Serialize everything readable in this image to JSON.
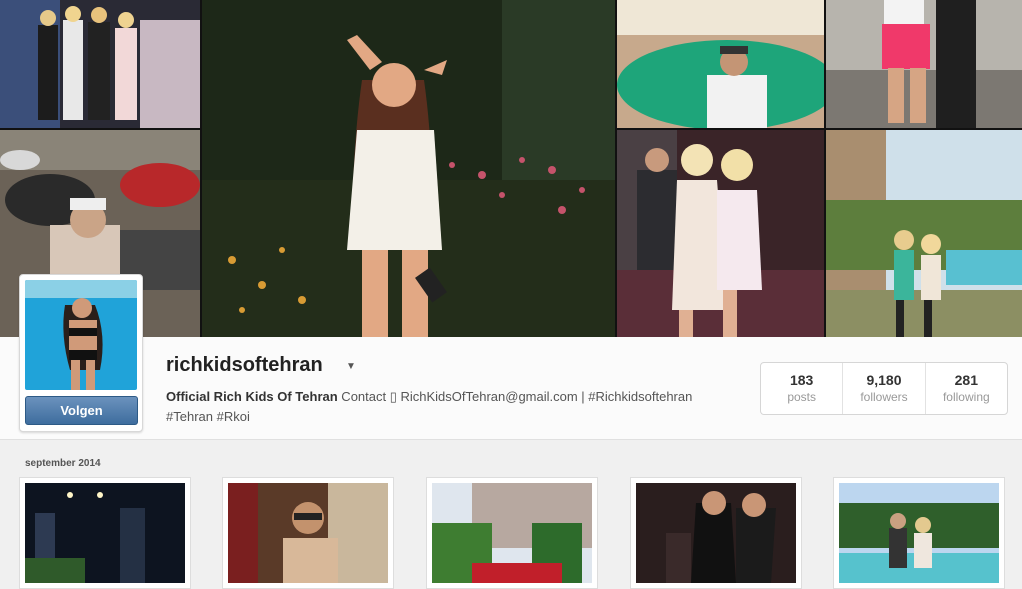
{
  "profile": {
    "username": "richkidsoftehran",
    "bio_name": "Official Rich Kids Of Tehran",
    "bio_rest": " Contact ▯ RichKidsOfTehran@gmail.com | #Richkidsoftehran",
    "bio_line2": "#Tehran #Rkoi",
    "follow_label": "Volgen"
  },
  "stats": [
    {
      "value": "183",
      "label": "posts"
    },
    {
      "value": "9,180",
      "label": "followers"
    },
    {
      "value": "281",
      "label": "following"
    }
  ],
  "section": {
    "label": "september 2014"
  },
  "icons": {
    "dropdown": "chevron-down-icon"
  },
  "colors": {
    "follow_button": "#4a76a8",
    "background": "#f0f0f0"
  }
}
